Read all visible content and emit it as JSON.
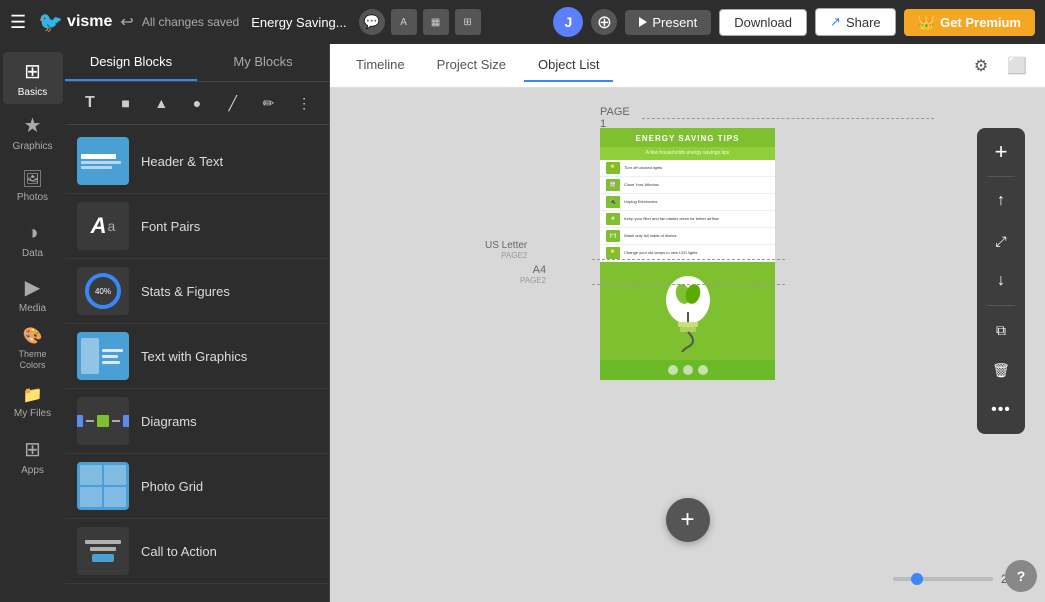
{
  "topbar": {
    "menu_icon": "☰",
    "logo_text": "visme",
    "undo_icon": "↩",
    "saved_text": "All changes saved",
    "project_name": "Energy Saving...",
    "present_label": "Present",
    "download_label": "Download",
    "share_label": "Share",
    "premium_label": "Get Premium"
  },
  "sidebar_icons": [
    {
      "id": "basics",
      "label": "Basics",
      "icon": "⊞"
    },
    {
      "id": "graphics",
      "label": "Graphics",
      "icon": "★"
    },
    {
      "id": "photos",
      "label": "Photos",
      "icon": "🖼"
    },
    {
      "id": "data",
      "label": "Data",
      "icon": "◑"
    },
    {
      "id": "media",
      "label": "Media",
      "icon": "▶"
    },
    {
      "id": "theme-colors",
      "label": "Theme Colors",
      "icon": "🎨"
    },
    {
      "id": "my-files",
      "label": "My Files",
      "icon": "📁"
    },
    {
      "id": "apps",
      "label": "Apps",
      "icon": "⊞"
    }
  ],
  "left_panel": {
    "tab_design_blocks": "Design Blocks",
    "tab_my_blocks": "My Blocks",
    "blocks": [
      {
        "id": "header-text",
        "label": "Header & Text",
        "thumb_type": "header-text"
      },
      {
        "id": "font-pairs",
        "label": "Font Pairs",
        "thumb_type": "font-pairs"
      },
      {
        "id": "stats-figures",
        "label": "Stats & Figures",
        "thumb_type": "stats"
      },
      {
        "id": "text-graphics",
        "label": "Text with Graphics",
        "thumb_type": "text-graphics"
      },
      {
        "id": "diagrams",
        "label": "Diagrams",
        "thumb_type": "diagrams"
      },
      {
        "id": "photo-grid",
        "label": "Photo Grid",
        "thumb_type": "photo-grid"
      },
      {
        "id": "call-to-action",
        "label": "Call to Action",
        "thumb_type": "cta"
      }
    ]
  },
  "canvas": {
    "tab_timeline": "Timeline",
    "tab_project_size": "Project Size",
    "tab_object_list": "Object List"
  },
  "page": {
    "label": "PAGE 1",
    "us_letter_label": "US Letter",
    "us_letter_sublabel": "PAGE2",
    "a4_label": "A4",
    "a4_sublabel": "PAGE2"
  },
  "slide": {
    "title": "ENERGY SAVING TIPS",
    "items": [
      "Turn off unused lights",
      "Close Your Window",
      "Unplug Electronics",
      "Keep your filter and fan blades clean for better airflow",
      "Wash only full loads of dishes",
      "Change your old lamps to new LED lights"
    ]
  },
  "zoom": {
    "value": "22%"
  },
  "help": {
    "label": "?"
  }
}
